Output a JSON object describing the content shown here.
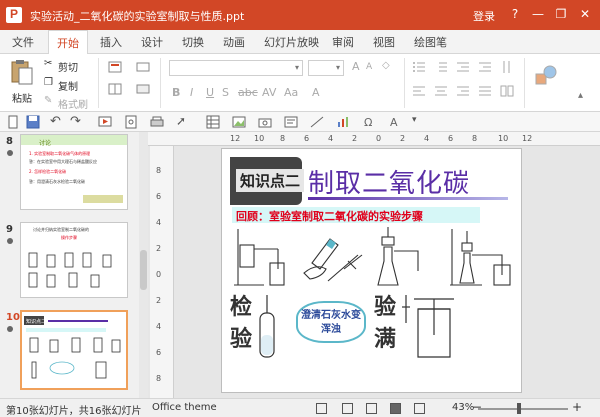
{
  "window": {
    "title": "实验活动_二氧化碳的实验室制取与性质.ppt",
    "login": "登录",
    "help": "?",
    "minimize": "—",
    "restore": "❐",
    "close": "✕"
  },
  "tabs": [
    "文件",
    "开始",
    "插入",
    "设计",
    "切换",
    "动画",
    "幻灯片放映",
    "审阅",
    "视图",
    "绘图笔"
  ],
  "ribbon": {
    "paste": "粘贴",
    "cut": "剪切",
    "copy": "复制",
    "format_painter": "格式刷"
  },
  "slides": [
    {
      "number": "8",
      "title": "讨论",
      "lines": [
        "1. 实验室制取二氧化碳气体的原理",
        "答：在实验室中用大理石与稀盐酸反应",
        "2. 怎样检验二氧化碳",
        "答：用澄清石灰水检验二氧化碳"
      ]
    },
    {
      "number": "9",
      "title": "讨论并归纳实验室制二氧化碳的",
      "subtitle": "操作步骤"
    },
    {
      "number": "10",
      "title": "知识点二",
      "selected": true
    }
  ],
  "slide": {
    "banner": "知识点二",
    "title": "制取二氧化碳",
    "review": "回顾：室验室制取二氧化碳的实验步骤",
    "left_char_1": "检",
    "left_char_2": "验",
    "right_char_1": "验",
    "right_char_2": "满",
    "bubble": "澄清石灰水变浑浊"
  },
  "ruler": {
    "h_ticks": [
      "12",
      "10",
      "8",
      "6",
      "4",
      "2",
      "0",
      "2",
      "4",
      "6",
      "8",
      "10",
      "12"
    ],
    "v_ticks": [
      "8",
      "6",
      "4",
      "2",
      "0",
      "2",
      "4",
      "6",
      "8"
    ]
  },
  "status": {
    "slide_info": "第10张幻灯片，共16张幻灯片",
    "theme": "Office theme",
    "zoom": "43%"
  },
  "colors": {
    "accent": "#d24726",
    "title_purple": "#5a2ea6",
    "review_red": "#e0001b"
  }
}
